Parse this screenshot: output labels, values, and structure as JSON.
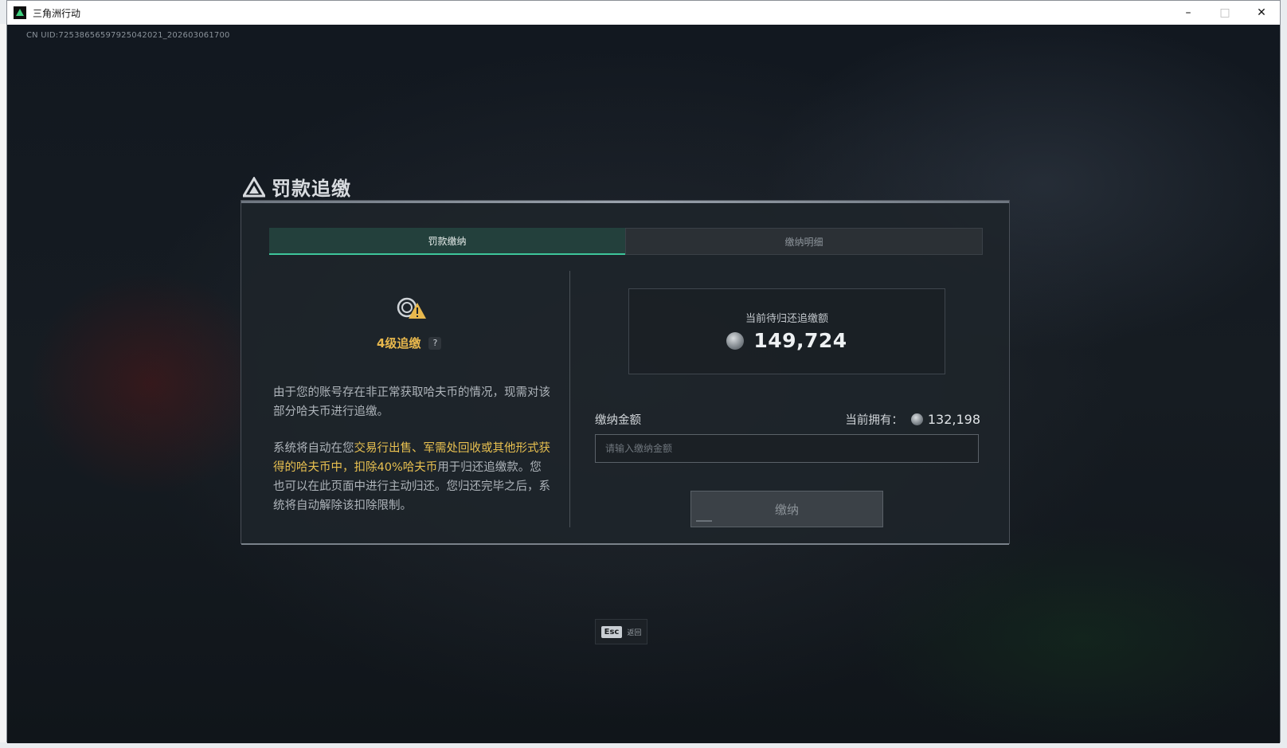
{
  "window": {
    "title": "三角洲行动",
    "controls": {
      "minimize": "–",
      "maximize": "□",
      "close": "✕"
    }
  },
  "game": {
    "uid": "CN UID:72538656597925042021_202603061700"
  },
  "modal": {
    "title": "罚款追缴",
    "tabs": [
      {
        "label": "罚款缴纳",
        "active": true
      },
      {
        "label": "缴纳明细",
        "active": false
      }
    ],
    "left": {
      "icon": "warning-coin-icon",
      "level": "4级追缴",
      "help": "?",
      "desc1": "由于您的账号存在非正常获取哈夫币的情况，现需对该部分哈夫币进行追缴。",
      "desc2_prefix": "系统将自动在您",
      "desc2_highlight": "交易行出售、军需处回收或其他形式获得的哈夫币中，扣除40%哈夫币",
      "desc2_suffix": "用于归还追缴款。您也可以在此页面中进行主动归还。您归还完毕之后，系统将自动解除该扣除限制。"
    },
    "right": {
      "owed_label": "当前待归还追缴额",
      "owed_value": "149,724",
      "pay_label": "缴纳金额",
      "own_label": "当前拥有：",
      "own_value": "132,198",
      "input_placeholder": "请输入缴纳金额",
      "pay_button": "缴纳"
    },
    "footer": {
      "esc_key": "Esc",
      "esc_label": "返回"
    }
  },
  "colors": {
    "accent_green": "#3ec59a",
    "highlight_gold": "#e8c050",
    "level_gold": "#e8b84d"
  }
}
